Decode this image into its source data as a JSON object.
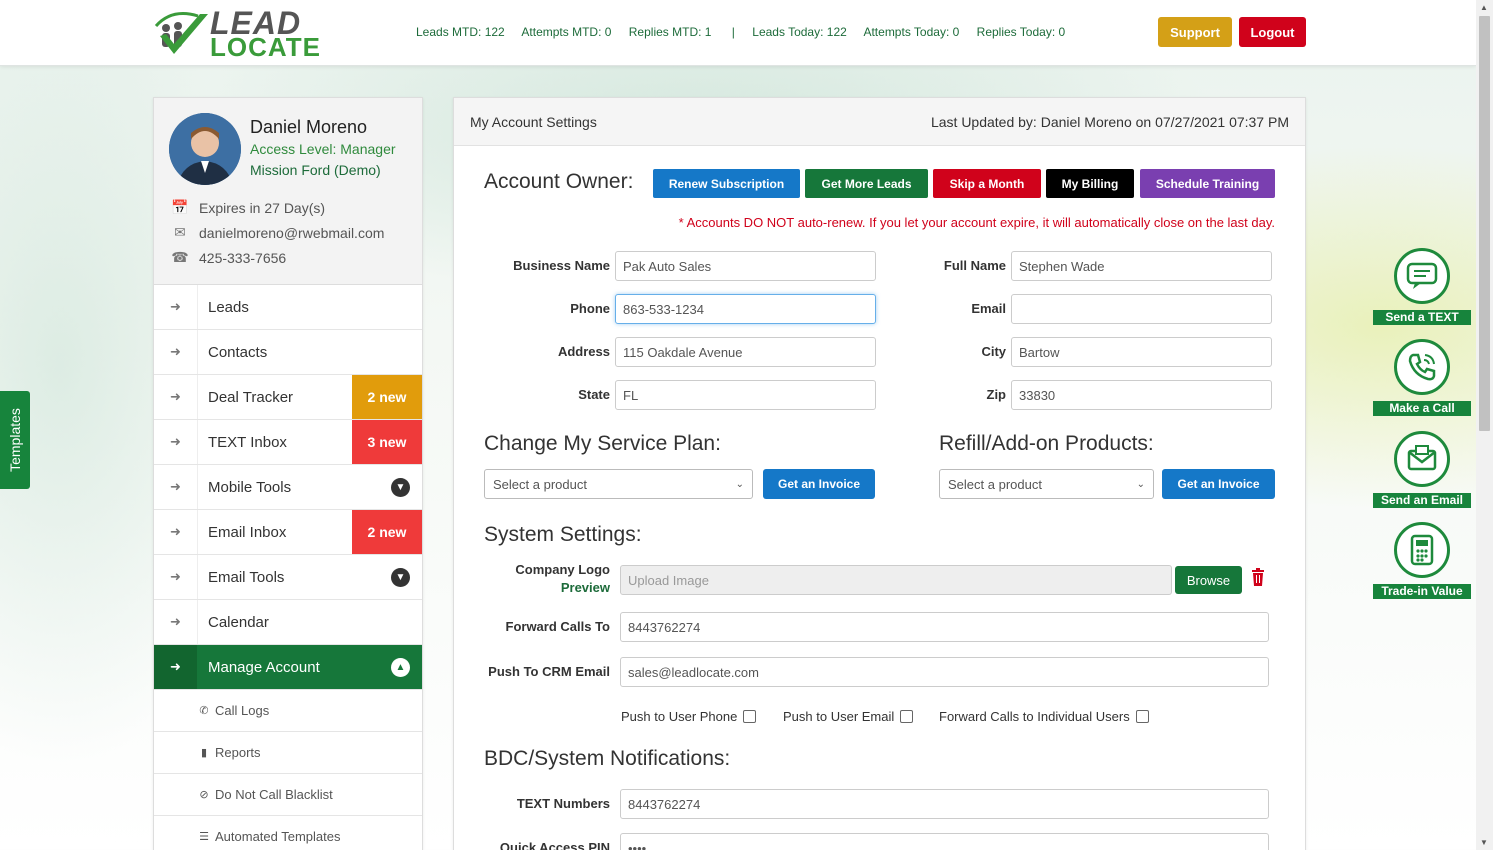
{
  "header": {
    "logo_line1": "LEAD",
    "logo_line2": "LOCATE",
    "stats": [
      "Leads MTD: 122",
      "Attempts MTD: 0",
      "Replies MTD: 1"
    ],
    "stats_separator": "|",
    "stats_today": [
      "Leads Today: 122",
      "Attempts Today: 0",
      "Replies Today: 0"
    ],
    "support_label": "Support",
    "logout_label": "Logout"
  },
  "templates_tab": "Templates",
  "profile": {
    "name": "Daniel Moreno",
    "access_level": "Access Level: Manager",
    "dealer": "Mission Ford (Demo)",
    "expires": "Expires in 27 Day(s)",
    "email": "danielmoreno@rwebmail.com",
    "phone": "425-333-7656"
  },
  "nav": {
    "items": [
      {
        "label": "Leads"
      },
      {
        "label": "Contacts"
      },
      {
        "label": "Deal Tracker",
        "badge": "2 new"
      },
      {
        "label": "TEXT Inbox",
        "badge": "3 new"
      },
      {
        "label": "Mobile Tools"
      },
      {
        "label": "Email Inbox",
        "badge": "2 new"
      },
      {
        "label": "Email Tools"
      },
      {
        "label": "Calendar"
      },
      {
        "label": "Manage Account"
      }
    ],
    "subitems": [
      {
        "label": "Call Logs"
      },
      {
        "label": "Reports"
      },
      {
        "label": "Do Not Call Blacklist"
      },
      {
        "label": "Automated Templates"
      }
    ]
  },
  "main": {
    "title": "My Account Settings",
    "last_updated": "Last Updated by: Daniel Moreno on 07/27/2021 07:37 PM",
    "account_owner_heading": "Account Owner:",
    "buttons": {
      "renew": "Renew Subscription",
      "more_leads": "Get More Leads",
      "skip": "Skip a Month",
      "billing": "My Billing",
      "training": "Schedule Training"
    },
    "autorenew_note": "* Accounts DO NOT auto-renew. If you let your account expire, it will automatically close on the last day.",
    "fields": {
      "business_name": {
        "label": "Business Name",
        "value": "Pak Auto Sales"
      },
      "phone": {
        "label": "Phone",
        "value": "863-533-1234"
      },
      "address": {
        "label": "Address",
        "value": "115 Oakdale Avenue"
      },
      "state": {
        "label": "State",
        "value": "FL"
      },
      "full_name": {
        "label": "Full Name",
        "value": "Stephen Wade"
      },
      "email": {
        "label": "Email",
        "value": ""
      },
      "city": {
        "label": "City",
        "value": "Bartow"
      },
      "zip": {
        "label": "Zip",
        "value": "33830"
      }
    },
    "service_plan_heading": "Change My Service Plan:",
    "refill_heading": "Refill/Add-on Products:",
    "select_placeholder": "Select a product",
    "invoice_label": "Get an Invoice",
    "system_settings_heading": "System Settings:",
    "company_logo_label": "Company Logo",
    "preview_label": "Preview",
    "upload_placeholder": "Upload Image",
    "browse_label": "Browse",
    "forward_calls_label": "Forward Calls To",
    "forward_calls_value": "8443762274",
    "push_crm_label": "Push To CRM Email",
    "push_crm_value": "sales@leadlocate.com",
    "checkboxes": [
      "Push to User Phone",
      "Push to User Email",
      "Forward Calls to Individual Users"
    ],
    "bdc_heading": "BDC/System Notifications:",
    "text_numbers_label": "TEXT Numbers",
    "text_numbers_value": "8443762274",
    "quick_pin_label": "Quick Access PIN",
    "quick_pin_value": "••••"
  },
  "right_actions": [
    "Send a TEXT",
    "Make a Call",
    "Send an Email",
    "Trade-in Value"
  ],
  "colors": {
    "brand_green": "#16773a",
    "orange": "#e19c0c",
    "red": "#ef3a3a",
    "blue": "#1578c8",
    "purple": "#7a3fb0"
  }
}
